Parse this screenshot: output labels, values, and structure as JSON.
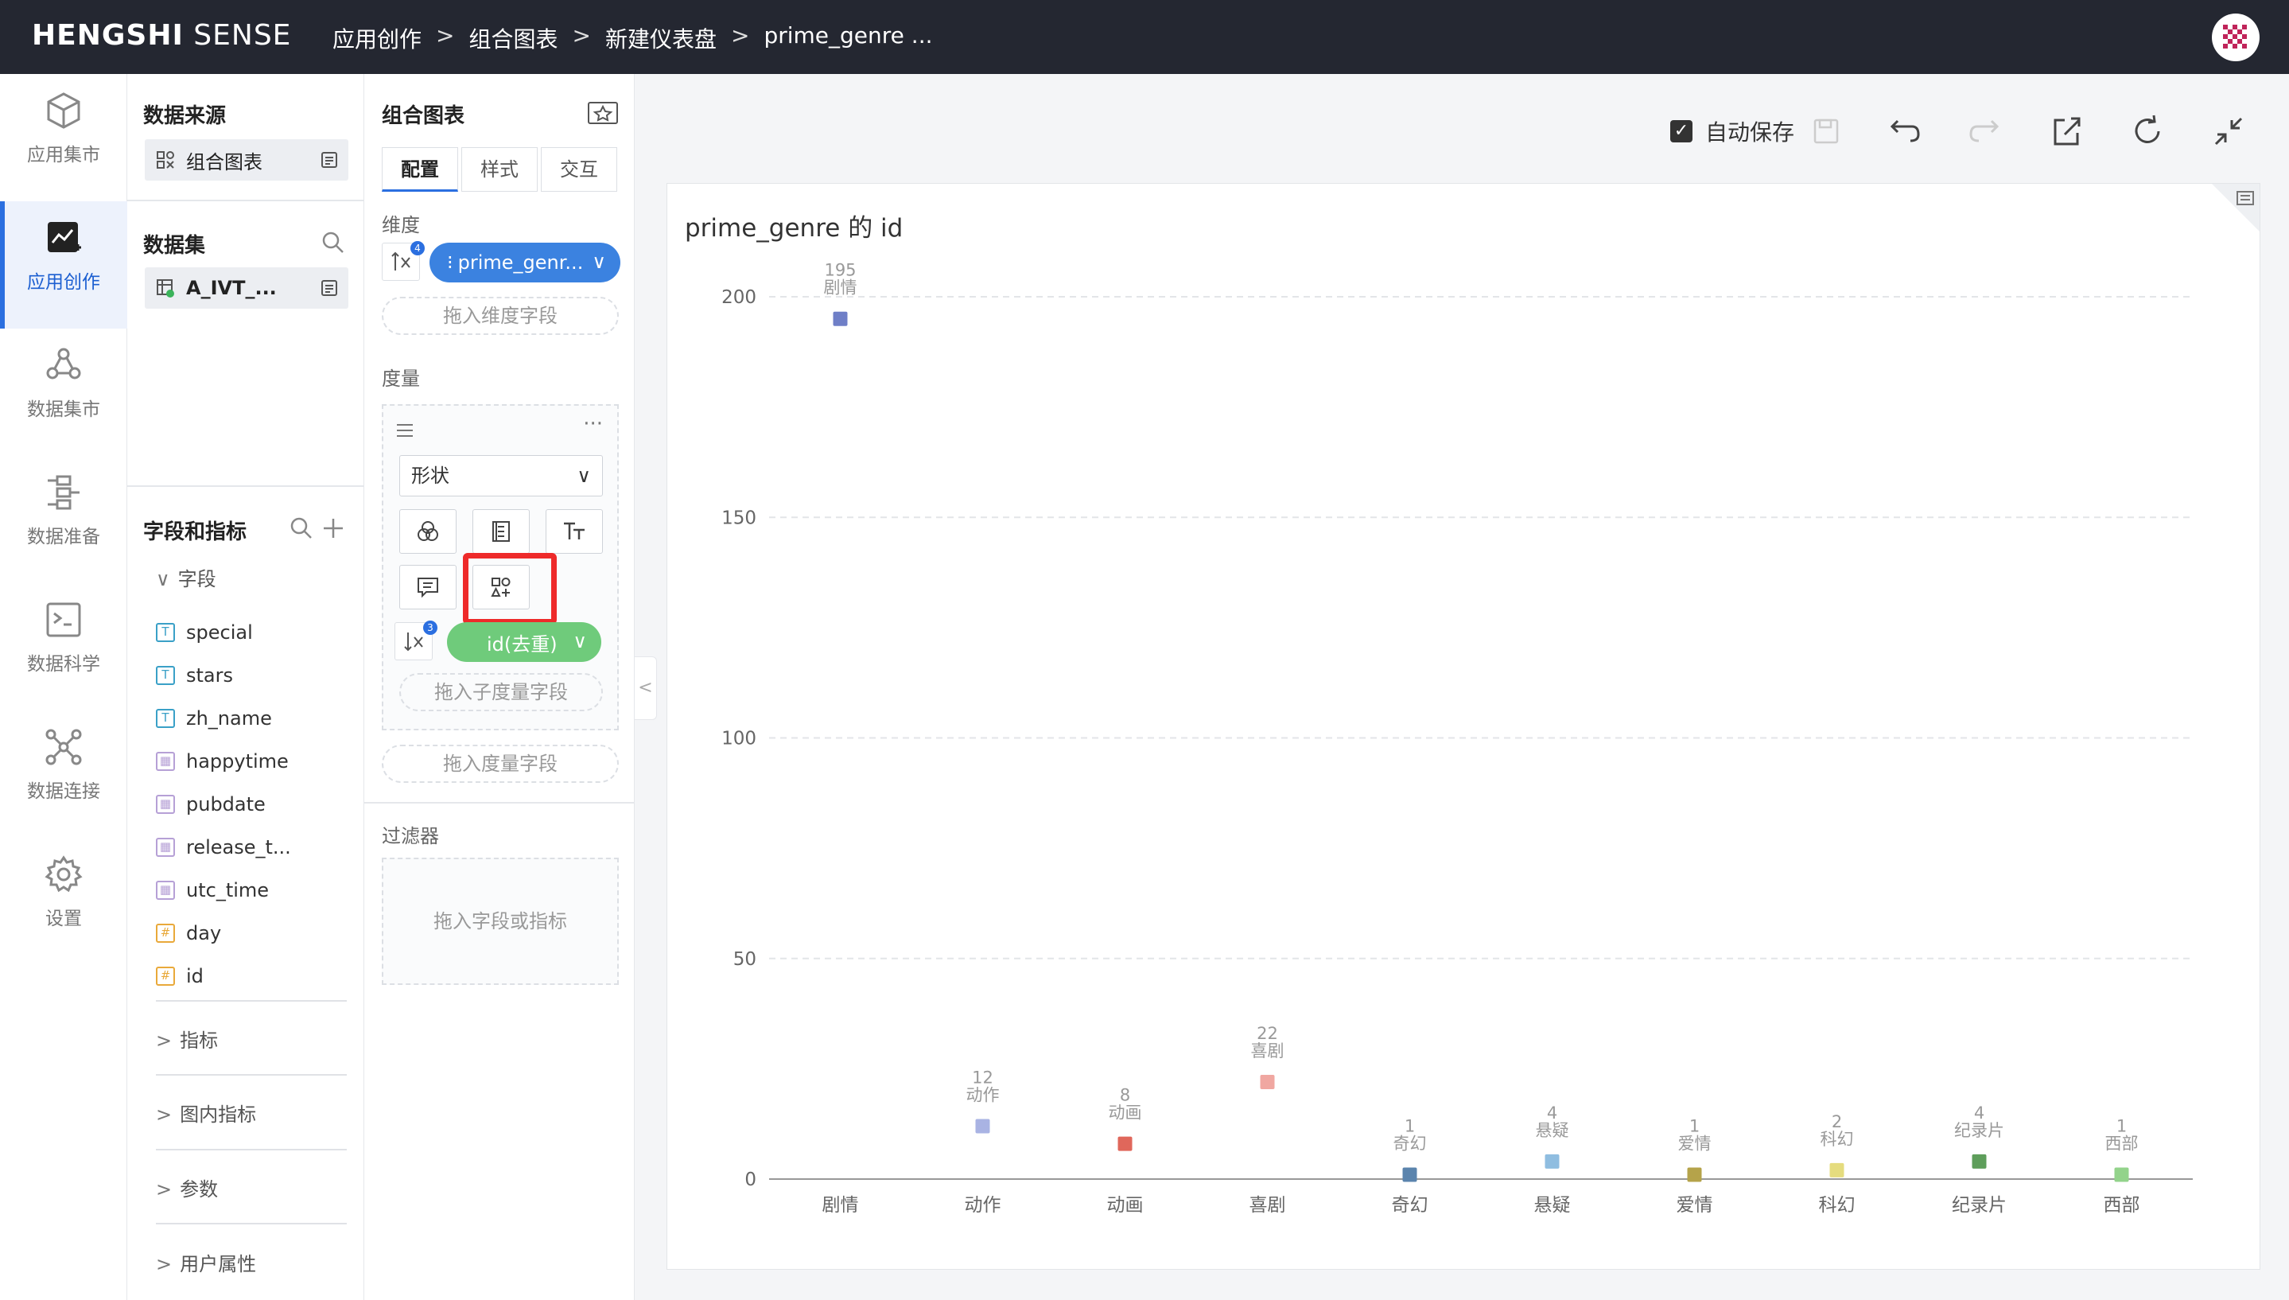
{
  "topbar": {
    "brand_bold": "HENGSHI",
    "brand_rest": " SENSE",
    "breadcrumb": [
      "应用创作",
      "组合图表",
      "新建仪表盘",
      "prime_genre ..."
    ],
    "separator": ">"
  },
  "nav": [
    {
      "label": "应用集市",
      "icon": "cube-icon"
    },
    {
      "label": "应用创作",
      "icon": "chart-edit-icon",
      "active": true
    },
    {
      "label": "数据集市",
      "icon": "data-mart-icon"
    },
    {
      "label": "数据准备",
      "icon": "data-prep-icon"
    },
    {
      "label": "数据科学",
      "icon": "terminal-icon"
    },
    {
      "label": "数据连接",
      "icon": "connection-icon"
    },
    {
      "label": "设置",
      "icon": "gear-icon"
    }
  ],
  "source_panel": {
    "source_title": "数据来源",
    "source_chip": "组合图表",
    "dataset_title": "数据集",
    "dataset_chip": "A_IVT_...",
    "fields_title": "字段和指标",
    "fields_group": "字段",
    "fields": [
      {
        "name": "special",
        "type": "T"
      },
      {
        "name": "stars",
        "type": "T"
      },
      {
        "name": "zh_name",
        "type": "T"
      },
      {
        "name": "happytime",
        "type": "date"
      },
      {
        "name": "pubdate",
        "type": "date"
      },
      {
        "name": "release_t...",
        "type": "date"
      },
      {
        "name": "utc_time",
        "type": "date"
      },
      {
        "name": "day",
        "type": "#"
      },
      {
        "name": "id",
        "type": "#"
      }
    ],
    "sections": [
      "指标",
      "图内指标",
      "参数",
      "用户属性"
    ]
  },
  "config_panel": {
    "title": "组合图表",
    "tabs": [
      "配置",
      "样式",
      "交互"
    ],
    "dimension_label": "维度",
    "dimension_badge": "4",
    "dimension_pill": "prime_genr...",
    "dimension_drop": "拖入维度字段",
    "measure_label": "度量",
    "shape_select": "形状",
    "measure_badge": "3",
    "measure_pill": "id(去重)",
    "sub_measure_drop": "拖入子度量字段",
    "measure_drop": "拖入度量字段",
    "filter_label": "过滤器",
    "filter_drop": "拖入字段或指标"
  },
  "toolbar": {
    "autosave_label": "自动保存",
    "autosave_checked": true
  },
  "chart_data": {
    "type": "scatter",
    "title": "prime_genre 的 id",
    "categories": [
      "剧情",
      "动作",
      "动画",
      "喜剧",
      "奇幻",
      "悬疑",
      "爱情",
      "科幻",
      "纪录片",
      "西部"
    ],
    "values": [
      195,
      12,
      8,
      22,
      1,
      4,
      1,
      2,
      4,
      1
    ],
    "colors": [
      "#6f7fc7",
      "#a9b3e3",
      "#e0675b",
      "#f0a7a1",
      "#5b84ad",
      "#8fbde0",
      "#b5a34a",
      "#e5dc7e",
      "#5e9e5b",
      "#93d38b"
    ],
    "ylim": [
      0,
      200
    ],
    "yticks": [
      0,
      50,
      100,
      150,
      200
    ],
    "grid": true,
    "xlabel": "",
    "ylabel": ""
  }
}
